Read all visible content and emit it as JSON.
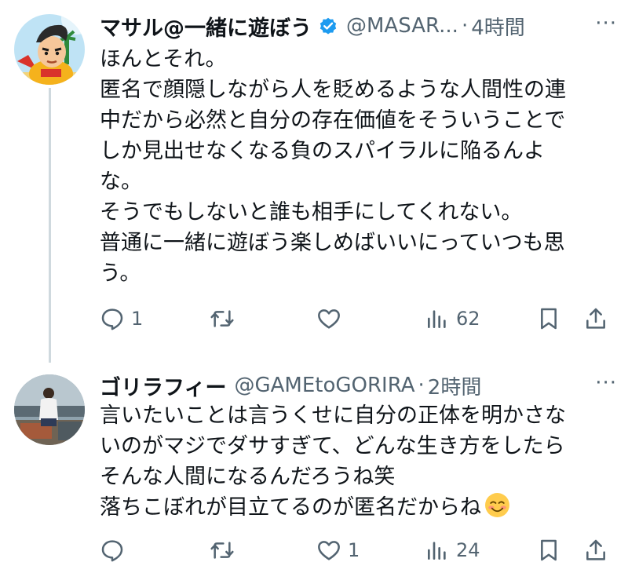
{
  "tweets": [
    {
      "display_name": "マサル@一緒に遊ぼう",
      "verified": true,
      "handle": "@MASAR...",
      "separator": "·",
      "time": "4時間",
      "more": "···",
      "avatar_icon": "cartoon-character-avatar",
      "lines": [
        "ほんとそれ。",
        "匿名で顔隠しながら人を貶めるような人間性の連",
        "中だから必然と自分の存在価値をそういうことで",
        "しか見出せなくなる負のスパイラルに陥るんよ",
        "な。",
        "そうでもしないと誰も相手にしてくれない。",
        "普通に一緒に遊ぼう楽しめばいいにっていつも思",
        "う。"
      ],
      "actions": {
        "reply_count": "1",
        "retweet_count": "",
        "like_count": "",
        "views_count": "62"
      }
    },
    {
      "display_name": "ゴリラフィー",
      "verified": false,
      "handle": "@GAMEtoGORIRA",
      "separator": "·",
      "time": "2時間",
      "more": "···",
      "avatar_icon": "photo-avatar",
      "lines": [
        "言いたいことは言うくせに自分の正体を明かさな",
        "いのがマジでダサすぎて、どんな生き方をしたら",
        "そんな人間になるんだろうね笑",
        "落ちこぼれが目立てるのが匿名だからね"
      ],
      "emoji": "smiling-face-emoji",
      "actions": {
        "reply_count": "",
        "retweet_count": "",
        "like_count": "1",
        "views_count": "24"
      }
    }
  ],
  "colors": {
    "text": "#0f1419",
    "muted": "#536471",
    "verified_blue": "#1d9bf0",
    "thread_line": "#cfd9de"
  }
}
